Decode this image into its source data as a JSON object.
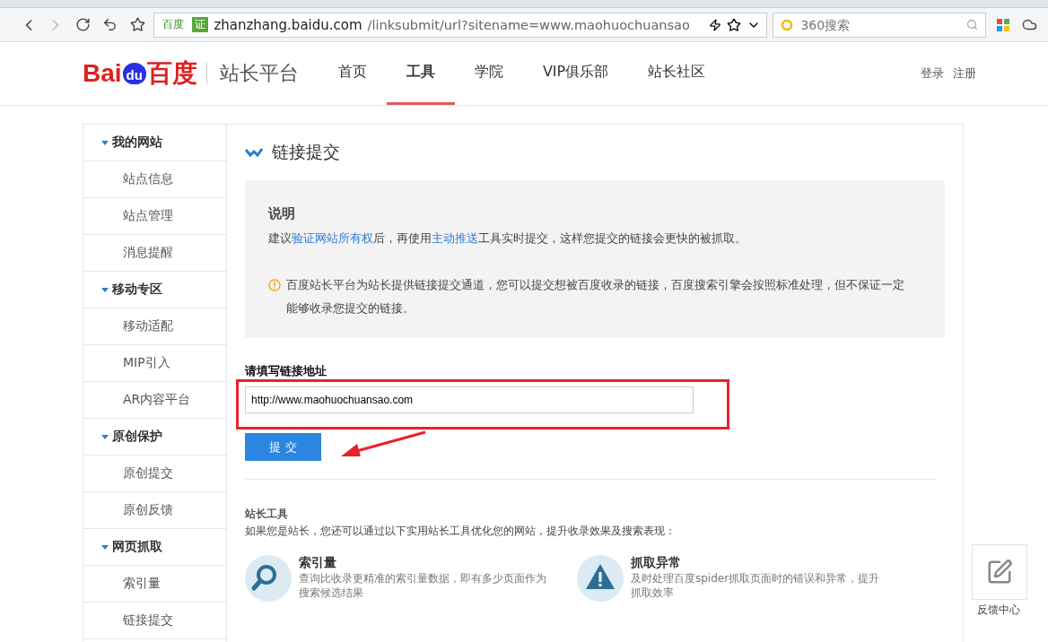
{
  "browser": {
    "url_badge": "百度",
    "verified_badge": "证",
    "url_host": "zhanzhang.baidu.com",
    "url_path": "/linksubmit/url?sitename=www.maohuochuansao",
    "search_placeholder": "360搜索"
  },
  "header": {
    "logo_left": "Bai",
    "logo_paw": "du",
    "logo_right": "百度",
    "platform": "站长平台",
    "nav": [
      {
        "label": "首页",
        "selected": false
      },
      {
        "label": "工具",
        "selected": true
      },
      {
        "label": "学院",
        "selected": false
      },
      {
        "label": "VIP俱乐部",
        "selected": false
      },
      {
        "label": "站长社区",
        "selected": false
      }
    ],
    "account": [
      "登录",
      "注册"
    ]
  },
  "sidebar": {
    "groups": [
      {
        "title": "我的网站",
        "expanded": true,
        "items": [
          "站点信息",
          "站点管理",
          "消息提醒"
        ]
      },
      {
        "title": "移动专区",
        "expanded": true,
        "items": [
          "移动适配",
          "MIP引入",
          "AR内容平台"
        ]
      },
      {
        "title": "原创保护",
        "expanded": true,
        "items": [
          "原创提交",
          "原创反馈"
        ]
      },
      {
        "title": "网页抓取",
        "expanded": true,
        "items": [
          "索引量",
          "链接提交"
        ]
      }
    ]
  },
  "content": {
    "title": "链接提交",
    "notice": {
      "heading": "说明",
      "line": [
        {
          "text": "建议",
          "link": false
        },
        {
          "text": "验证网站所有权",
          "link": true
        },
        {
          "text": "后，再使用",
          "link": false
        },
        {
          "text": "主动推送",
          "link": true
        },
        {
          "text": "工具实时提交，这样您提交的链接会更快的被抓取。",
          "link": false
        }
      ],
      "warning": "百度站长平台为站长提供链接提交通道，您可以提交想被百度收录的链接，百度搜索引擎会按照标准处理，但不保证一定能够收录您提交的链接。"
    },
    "form": {
      "label": "请填写链接地址",
      "value": "http://www.maohuochuansao.com",
      "submit": "提 交",
      "highlighted": true
    },
    "tools": {
      "heading": "站长工具",
      "intro": "如果您是站长，您还可以通过以下实用站长工具优化您的网站，提升收录效果及搜索表现：",
      "items": [
        {
          "kind": "magnifier",
          "title": "索引量",
          "desc": "查询比收录更精准的索引量数据，即有多少页面作为搜索候选结果"
        },
        {
          "kind": "warning",
          "title": "抓取异常",
          "desc": "及时处理百度spider抓取页面时的错误和异常，提升抓取效率"
        }
      ]
    }
  },
  "feedback": {
    "label": "反馈中心"
  }
}
